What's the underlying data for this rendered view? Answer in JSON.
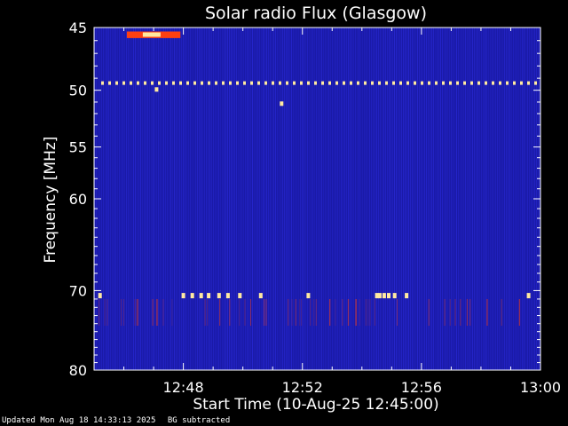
{
  "chart_data": {
    "type": "heatmap",
    "title": "Solar radio Flux (Glasgow)",
    "xlabel": "Start Time (10-Aug-25 12:45:00)",
    "ylabel": "Frequency [MHz]",
    "x_range_min": [
      0,
      15
    ],
    "y_range_mhz": [
      45,
      80
    ],
    "y_scale": "log",
    "x_ticks": [
      {
        "min": 3,
        "label": "12:48"
      },
      {
        "min": 7,
        "label": "12:52"
      },
      {
        "min": 11,
        "label": "12:56"
      },
      {
        "min": 15,
        "label": "13:00"
      }
    ],
    "y_ticks": [
      {
        "mhz": 45,
        "label": "45"
      },
      {
        "mhz": 50,
        "label": "50"
      },
      {
        "mhz": 55,
        "label": "55"
      },
      {
        "mhz": 60,
        "label": "60"
      },
      {
        "mhz": 70,
        "label": "70"
      },
      {
        "mhz": 80,
        "label": "80"
      }
    ],
    "colors": {
      "background": "#1a1aa8",
      "noise": "#2a2ad8",
      "hot": "#ffe9a0",
      "warm": "#ff4010",
      "frame": "#ffffff"
    },
    "features": {
      "interference_line_mhz": 49.4,
      "burst": {
        "t_start": 1.1,
        "t_end": 2.9,
        "mhz_low": 45.3,
        "mhz_high": 45.8
      },
      "spot_points": [
        {
          "t": 2.1,
          "mhz": 49.9
        },
        {
          "t": 6.3,
          "mhz": 51.1
        }
      ],
      "band_70_mhz": 70.6,
      "band_70_times": [
        0.2,
        3.0,
        3.3,
        3.6,
        3.85,
        4.2,
        4.5,
        4.9,
        5.6,
        7.2,
        9.5,
        9.6,
        9.75,
        9.9,
        10.1,
        10.5,
        14.6
      ]
    }
  },
  "footer": {
    "updated": "Updated Mon Aug 18 14:33:13 2025",
    "note": "BG subtracted"
  }
}
